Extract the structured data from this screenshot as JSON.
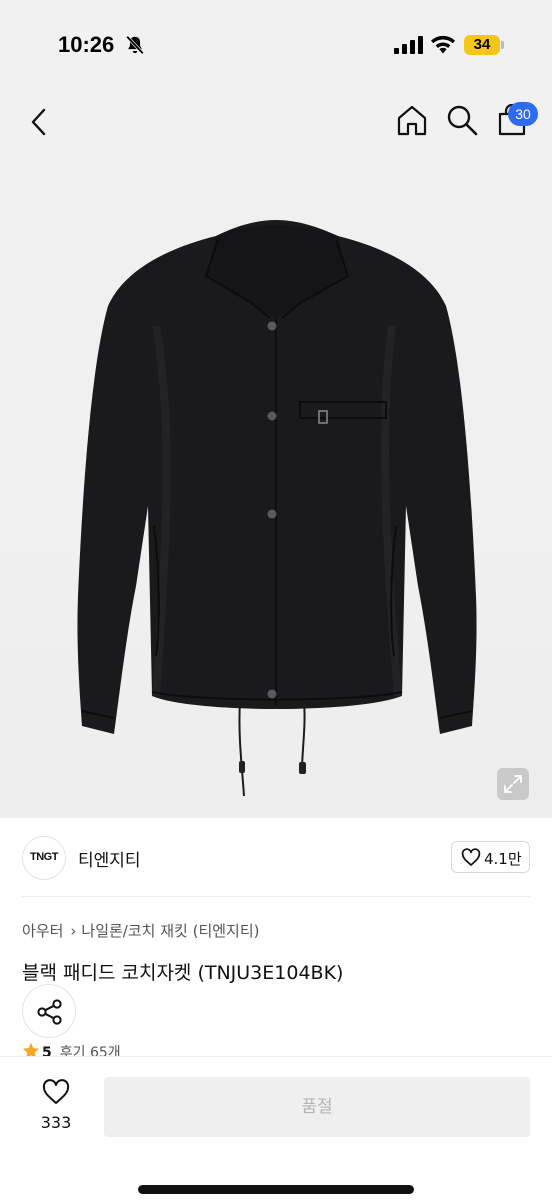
{
  "status_bar": {
    "time": "10:26",
    "battery": "34",
    "icons": [
      "bell-off-icon",
      "signal-icon",
      "wifi-icon",
      "battery-icon"
    ]
  },
  "nav": {
    "icons": [
      "back-icon",
      "home-icon",
      "search-icon",
      "bag-icon"
    ],
    "bag_badge": "30",
    "badge_color": "#2f6bf0"
  },
  "product": {
    "brand_logo": "TNGT",
    "brand_name": "티엔지티",
    "like_count": "4.1만",
    "breadcrumb": [
      "아우터",
      "나일론/코치 재킷 (티엔지티)"
    ],
    "title": "블랙 패디드 코치자켓 (TNJU3E104BK)",
    "rating": "5",
    "review_label": "후기",
    "review_count": "65개",
    "star_color": "#f5a623"
  },
  "bottom_bar": {
    "wish_count": "333",
    "soldout_label": "품절"
  }
}
